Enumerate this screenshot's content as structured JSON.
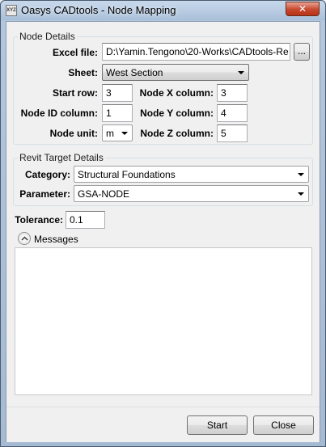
{
  "window": {
    "app_icon_text": "XYZ",
    "title": "Oasys CADtools - Node Mapping",
    "close_glyph": "✕"
  },
  "node_details": {
    "legend": "Node Details",
    "excel_file_label": "Excel file:",
    "excel_file_value": "D:\\Yamin.Tengono\\20-Works\\CADtools-Re",
    "browse_label": "...",
    "sheet_label": "Sheet:",
    "sheet_value": "West Section",
    "start_row_label": "Start row:",
    "start_row_value": "3",
    "node_id_column_label": "Node ID column:",
    "node_id_column_value": "1",
    "node_unit_label": "Node unit:",
    "node_unit_value": "m",
    "node_x_column_label": "Node X column:",
    "node_x_column_value": "3",
    "node_y_column_label": "Node Y column:",
    "node_y_column_value": "4",
    "node_z_column_label": "Node Z column:",
    "node_z_column_value": "5"
  },
  "revit_target": {
    "legend": "Revit Target Details",
    "category_label": "Category:",
    "category_value": "Structural Foundations",
    "parameter_label": "Parameter:",
    "parameter_value": "GSA-NODE"
  },
  "tolerance": {
    "label": "Tolerance:",
    "value": "0.1"
  },
  "messages": {
    "label": "Messages",
    "content": ""
  },
  "actions": {
    "start_label": "Start",
    "close_label": "Close"
  }
}
